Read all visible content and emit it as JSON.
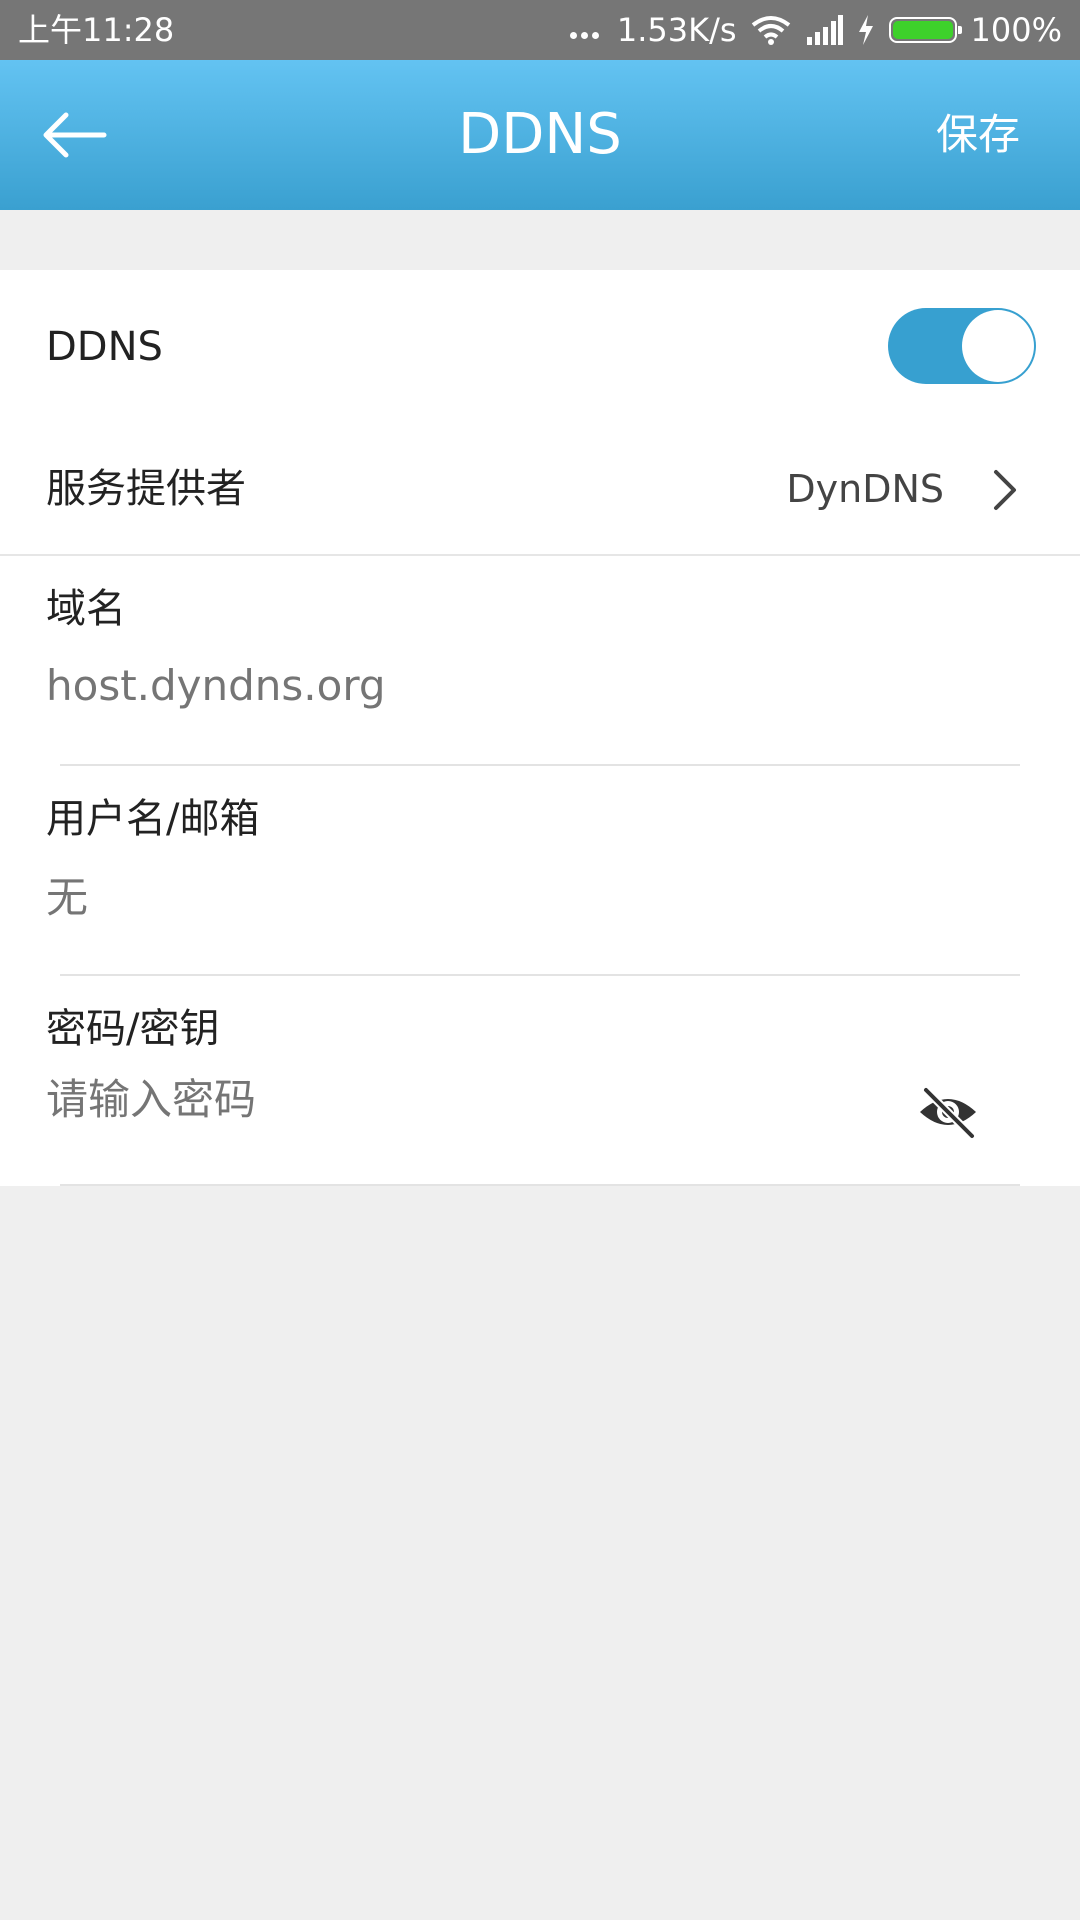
{
  "status_bar": {
    "time": "上午11:28",
    "net_speed": "1.53K/s",
    "battery_percent": "100%",
    "battery_level": 1.0,
    "icons": [
      "more-dots-icon",
      "wifi-icon",
      "signal-icon",
      "charging-icon",
      "battery-icon"
    ]
  },
  "app_bar": {
    "title": "DDNS",
    "save_label": "保存",
    "back_icon": "back-arrow-icon"
  },
  "ddns_row": {
    "label": "DDNS",
    "enabled": true
  },
  "provider_row": {
    "label": "服务提供者",
    "value": "DynDNS",
    "icon": "chevron-right-icon"
  },
  "domain_field": {
    "label": "域名",
    "value": "",
    "placeholder": "host.dyndns.org"
  },
  "username_field": {
    "label": "用户名/邮箱",
    "value": "",
    "placeholder": "无"
  },
  "password_field": {
    "label": "密码/密钥",
    "value": "",
    "placeholder": "请输入密码",
    "icon": "eye-off-icon"
  },
  "colors": {
    "status_bar": "#767676",
    "app_bar_top": "#63c3f2",
    "app_bar_bottom": "#3aa0d0",
    "accent": "#37a0d0",
    "background": "#efefef",
    "battery_fill": "#3ed12b"
  }
}
